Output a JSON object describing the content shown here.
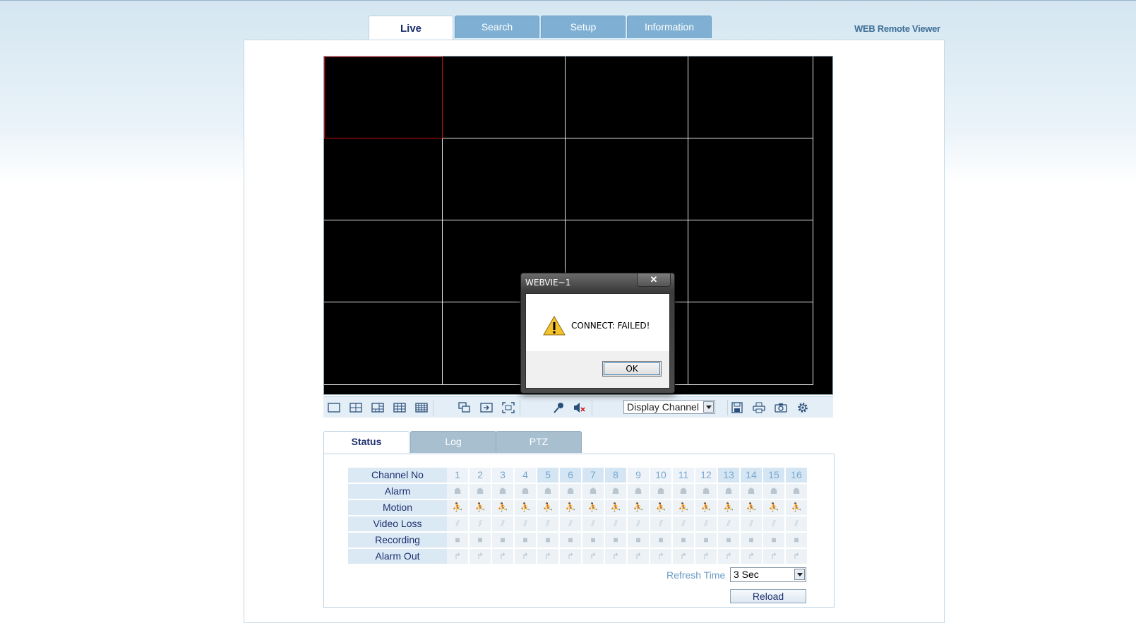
{
  "top_tabs": [
    {
      "label": "Live",
      "active": true
    },
    {
      "label": "Search",
      "active": false
    },
    {
      "label": "Setup",
      "active": false
    },
    {
      "label": "Information",
      "active": false
    }
  ],
  "brand": "WEB Remote Viewer",
  "video": {
    "layout": "4x4",
    "channels": 16,
    "selected_channel": 1
  },
  "toolbar": {
    "display_channel": "Display Channel",
    "icons": [
      "layout-1-icon",
      "layout-4-icon",
      "layout-6-icon",
      "layout-9-icon",
      "layout-16-icon",
      "sequence-icon",
      "next-channel-icon",
      "fullscreen-icon",
      "microphone-icon",
      "speaker-mute-icon",
      "save-icon",
      "print-icon",
      "camera-snapshot-icon",
      "settings-gear-icon"
    ]
  },
  "sub_tabs": [
    {
      "label": "Status",
      "active": true
    },
    {
      "label": "Log",
      "active": false
    },
    {
      "label": "PTZ",
      "active": false
    }
  ],
  "status": {
    "rows": [
      "Channel No",
      "Alarm",
      "Motion",
      "Video Loss",
      "Recording",
      "Alarm Out"
    ],
    "channels": [
      "1",
      "2",
      "3",
      "4",
      "5",
      "6",
      "7",
      "8",
      "9",
      "10",
      "11",
      "12",
      "13",
      "14",
      "15",
      "16"
    ],
    "refresh_label": "Refresh Time",
    "refresh_value": "3 Sec",
    "reload_label": "Reload"
  },
  "dialog": {
    "title": "WEBVIE~1",
    "close": "✕",
    "message": "CONNECT: FAILED!",
    "ok": "OK"
  }
}
